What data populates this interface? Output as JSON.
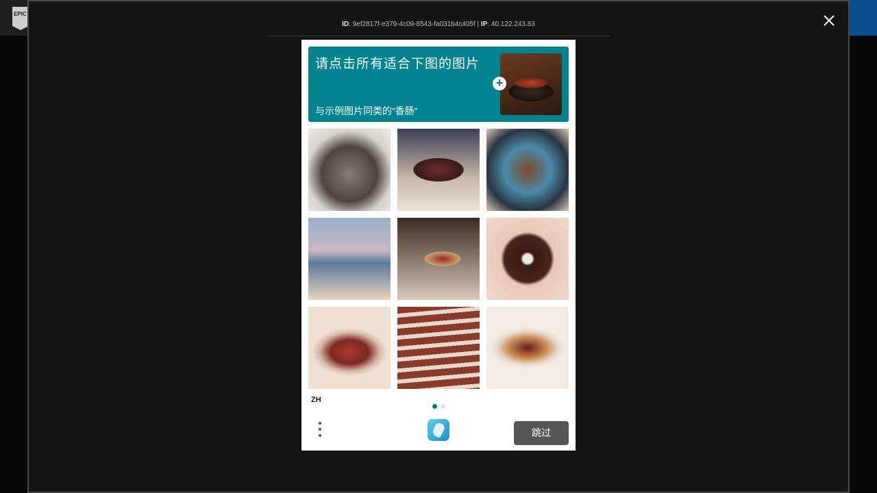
{
  "background": {
    "logo_text": "EPIC",
    "accent_color": "#0a4d91"
  },
  "modal": {
    "meta_id_label": "ID",
    "meta_id_value": ": 9ef2817f-e379-4c09-8543-fa031b4c405f | ",
    "meta_ip_label": "IP",
    "meta_ip_value": ": 40.122.243.83"
  },
  "captcha": {
    "prompt_title": "请点击所有适合下图的图片",
    "prompt_sub": "与示例图片同类的“香肠”",
    "accent_color": "#00838f",
    "language": "ZH",
    "skip_label": "跳过",
    "pages": [
      {
        "active": true
      },
      {
        "active": false
      }
    ],
    "tiles": [
      "sausages-on-plate",
      "chocolate-eclairs",
      "roast-chicken",
      "beach-scene",
      "hot-dogs-in-bowl",
      "chocolate-donut",
      "beans-in-bowl",
      "sausages-row",
      "hot-dogs-buns"
    ]
  }
}
